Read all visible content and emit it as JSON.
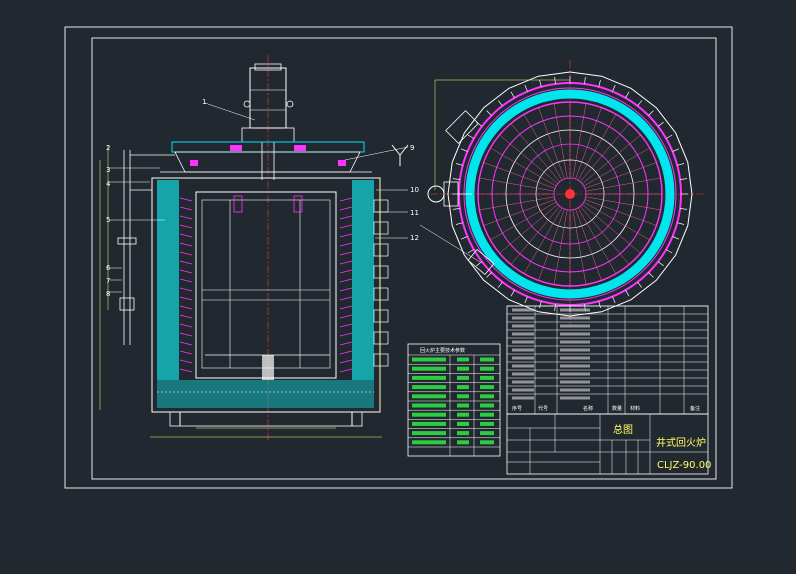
{
  "title_block": {
    "drawing_type": "总图",
    "product_name": "井式回火炉",
    "drawing_no": "CLJZ-90.00"
  },
  "part_numbers": [
    "1",
    "2",
    "3",
    "4",
    "5",
    "6",
    "7",
    "8",
    "9",
    "10",
    "11",
    "12"
  ],
  "bom_header": {
    "seq": "序号",
    "code": "代号",
    "name": "名称",
    "qty": "数量",
    "material": "材料",
    "note": "备注"
  },
  "spec_table_title": "回火炉主要技术参数",
  "colors": {
    "background": "#212830",
    "frame": "#ffffff",
    "insulation": "#00e5ee",
    "heating_element": "#ff33ff",
    "center_line": "#ff3333",
    "dimension": "#ffff66",
    "outline": "#ffffff"
  }
}
